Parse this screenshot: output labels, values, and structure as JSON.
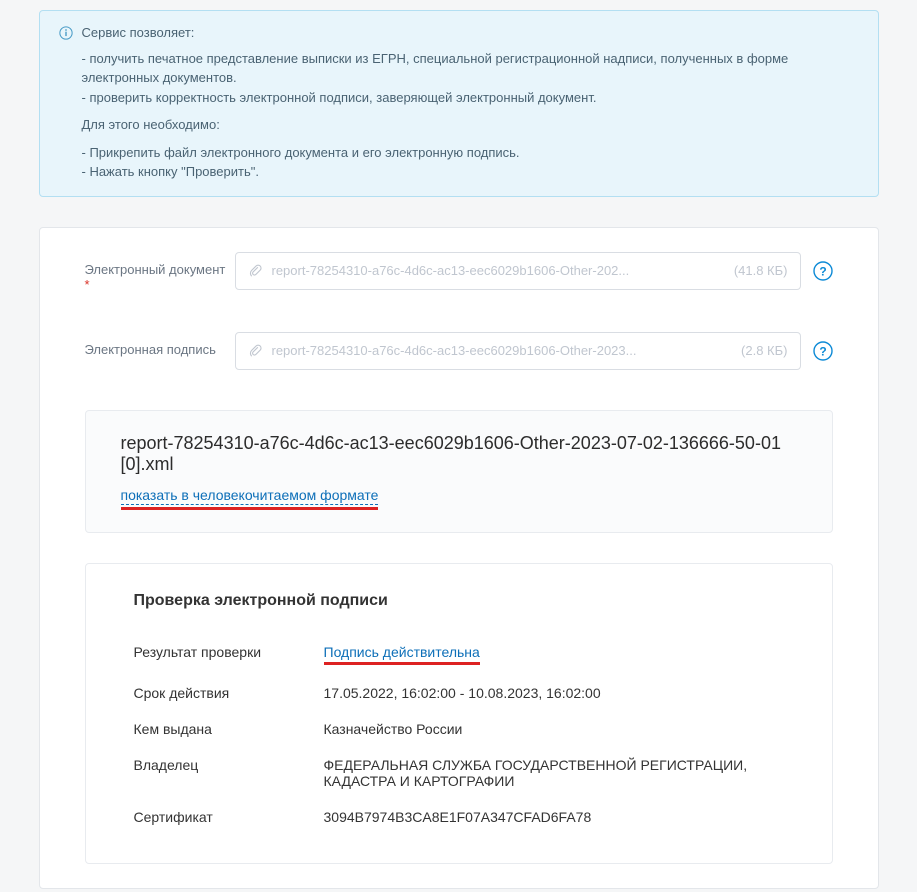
{
  "info": {
    "title": "Сервис позволяет:",
    "bullet1": "- получить печатное представление выписки из ЕГРН, специальной регистрационной надписи, полученных в форме электронных документов.",
    "bullet2": "- проверить корректность электронной подписи, заверяющей электронный документ.",
    "need": "Для этого необходимо:",
    "step1": "- Прикрепить файл электронного документа и его электронную подпись.",
    "step2": "- Нажать кнопку \"Проверить\"."
  },
  "fields": {
    "doc_label": "Электронный документ",
    "sig_label": "Электронная подпись",
    "doc_file": "report-78254310-a76c-4d6c-ac13-eec6029b1606-Other-202...",
    "doc_size": "(41.8 КБ)",
    "sig_file": "report-78254310-a76c-4d6c-ac13-eec6029b1606-Other-2023...",
    "sig_size": "(2.8 КБ)"
  },
  "result": {
    "filename": "report-78254310-a76c-4d6c-ac13-eec6029b1606-Other-2023-07-02-136666-50-01[0].xml",
    "human_link": "показать в человекочитаемом формате"
  },
  "signature": {
    "title": "Проверка электронной подписи",
    "rows": {
      "result_label": "Результат проверки",
      "result_value": "Подпись действительна",
      "validity_label": "Срок действия",
      "validity_value": "17.05.2022, 16:02:00 - 10.08.2023, 16:02:00",
      "issuer_label": "Кем выдана",
      "issuer_value": "Казначейство России",
      "owner_label": "Владелец",
      "owner_value": "ФЕДЕРАЛЬНАЯ СЛУЖБА ГОСУДАРСТВЕННОЙ РЕГИСТРАЦИИ, КАДАСТРА И КАРТОГРАФИИ",
      "cert_label": "Сертификат",
      "cert_value": "3094B7974B3CA8E1F07A347CFAD6FA78"
    }
  }
}
